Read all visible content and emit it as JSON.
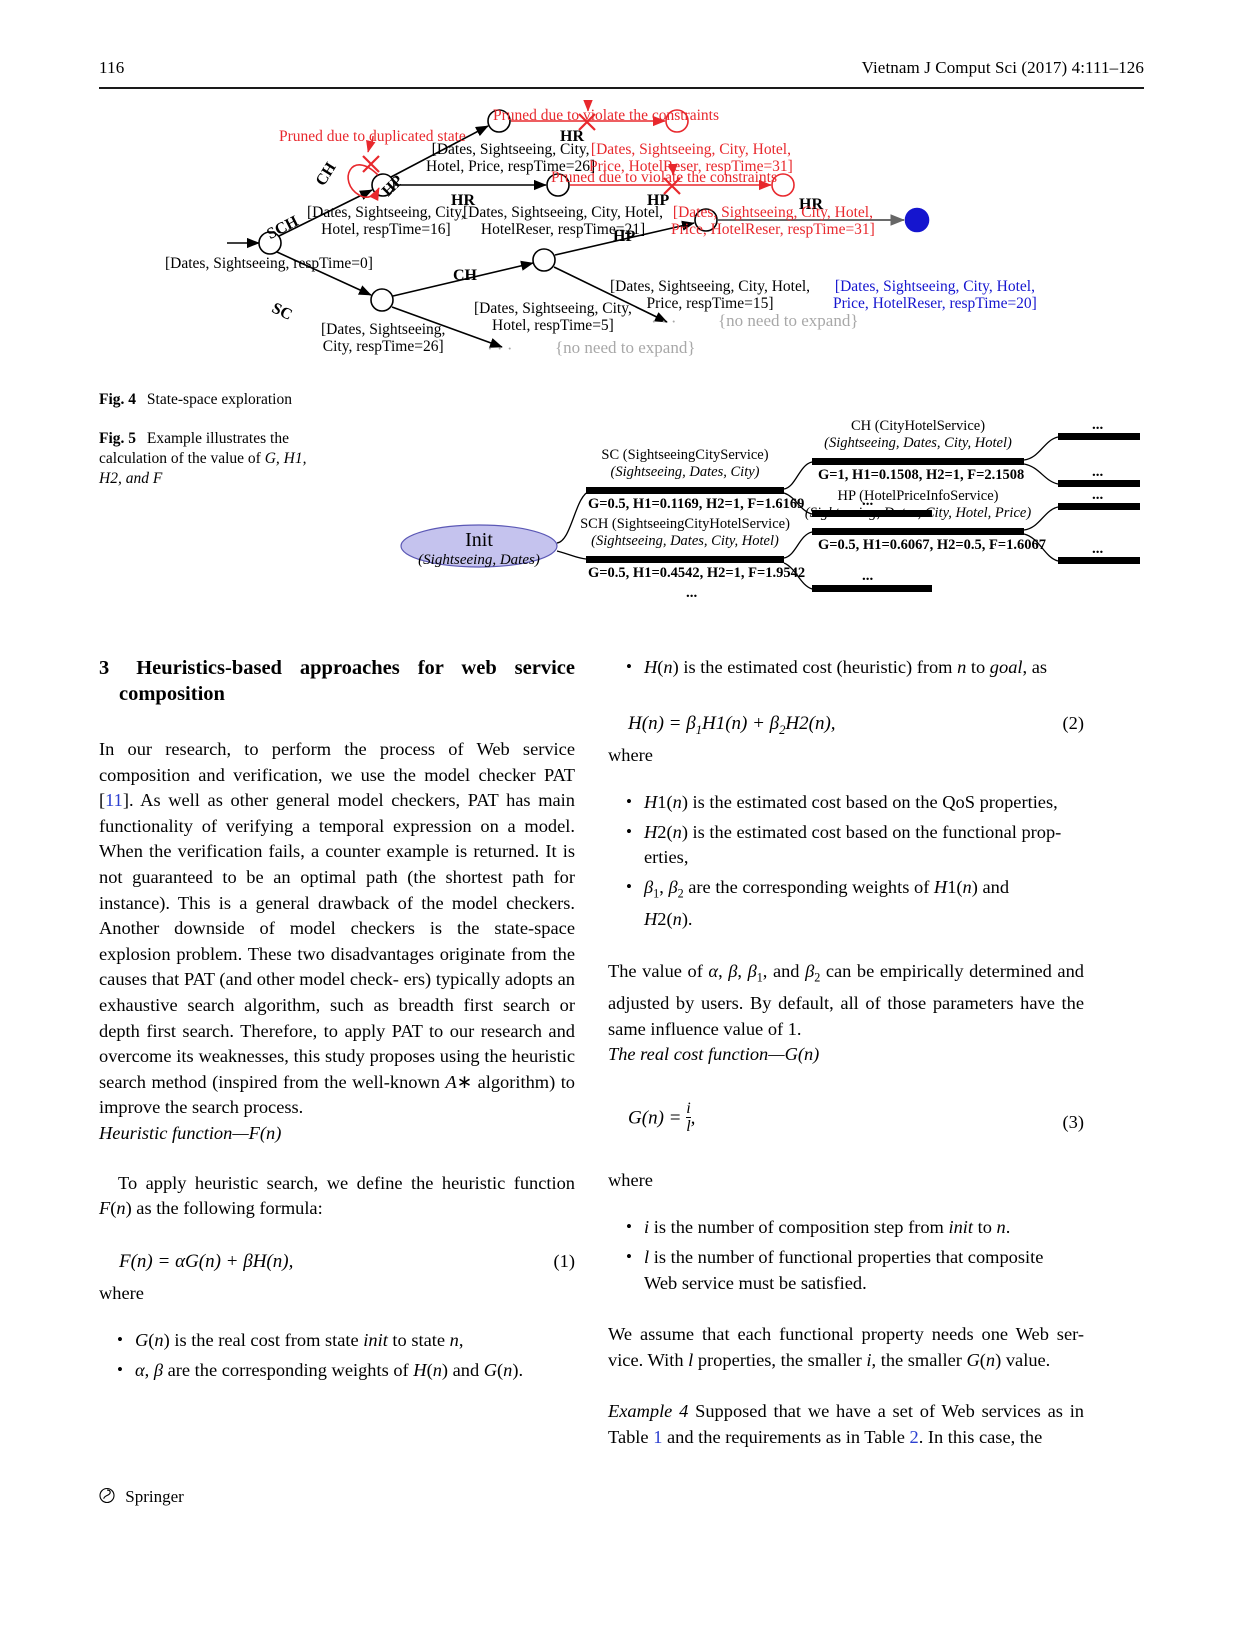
{
  "header": {
    "page_number": "116",
    "journal_ref": "Vietnam J Comput Sci (2017) 4:111–126"
  },
  "figure4": {
    "caption_label": "Fig. 4",
    "caption_text": "State-space exploration",
    "annotations": {
      "pruned_duplicated": "Pruned due to duplicated state",
      "pruned_constraints_1": "Pruned due to violate  the  constraints",
      "pruned_constraints_2": "Pruned due to violate the constraints",
      "pruned_constraints_3": "Pruned due to violate the constraints",
      "no_need_expand_1": "{no need to expand}",
      "no_need_expand_2": "{no need to expand}",
      "ellipsis_1": "· · ·",
      "ellipsis_2": "· · ·"
    },
    "edge_labels": {
      "ch_loop": "CH",
      "hp_up": "HP",
      "sch": "SCH",
      "hr_top": "HR",
      "hr_mid": "HR",
      "hp_mid": "HP",
      "sc": "SC",
      "ch_low": "CH",
      "hp_low": "HP",
      "hr_low": "HR"
    },
    "states": {
      "init": "[Dates, Sightseeing, respTime=0]",
      "sch_node": "[Dates, Sightseeing, City,\nHotel, respTime=16]",
      "hr_node": "[Dates, Sightseeing, City, Hotel,\nHotelReser, respTime=21]",
      "hp_top_node": "[Dates, Sightseeing, City,\nHotel, Price, respTime=26]",
      "hr_top_pruned": "[Dates, Sightseeing, City, Hotel,\nPrice, HotelReser, respTime=31]",
      "hp_mid_pruned": "[Dates, Sightseeing, City, Hotel,\nPrice, HotelReser, respTime=31]",
      "sc_node": "[Dates, Sightseeing,\nCity, respTime=26]",
      "ch_node": "[Dates, Sightseeing, City,\nHotel, respTime=5]",
      "hp_node": "[Dates, Sightseeing, City, Hotel,\nPrice, respTime=15]",
      "goal_node": "[Dates, Sightseeing, City, Hotel,\nPrice, HotelReser, respTime=20]"
    },
    "colors": {
      "pruned": "#e8282d",
      "goal": "#1515cf",
      "normal": "#000000",
      "faded": "#a8a8a8"
    }
  },
  "figure5": {
    "caption_label": "Fig. 5",
    "caption_line1": "Example illustrates the",
    "caption_line2": "calculation of the value of",
    "caption_line3": "G, H1, H2, and F",
    "root": {
      "name": "Init",
      "properties": "(Sightseeing, Dates)",
      "fill": "#c5c3ee"
    },
    "level1": [
      {
        "title": "SC (SightseeingCityService)",
        "properties": "(Sightseeing, Dates, City)",
        "values": "G=0.5, H1=0.1169, H2=1, F=1.6169"
      },
      {
        "title": "SCH (SightseeingCityHotelService)",
        "properties": "(Sightseeing, Dates, City, Hotel)",
        "values": "G=0.5, H1=0.4542, H2=1, F=1.9542"
      }
    ],
    "level2": [
      {
        "title": "CH (CityHotelService)",
        "properties": "(Sightseeing, Dates, City, Hotel)",
        "values": "G=1, H1=0.1508, H2=1, F=2.1508"
      },
      {
        "title": "HP (HotelPriceInfoService)",
        "properties": "(Sightseeing, Dates, City, Hotel, Price)",
        "values": "G=0.5, H1=0.6067, H2=0.5, F=1.6067"
      }
    ],
    "ellipsis": "..."
  },
  "section": {
    "number": "3",
    "title": "Heuristics-based approaches for web service composition"
  },
  "left_column": {
    "para1": "In our research, to perform the process of Web service composition and verification, we use the model checker PAT [11]. As well as other general model checkers, PAT has main functionality of verifying a temporal expression on a model. When the verification fails, a counter example is returned. It is not guaranteed to be an optimal path (the shortest path for instance). This is a general drawback of the model checkers. Another downside of model checkers is the state-space explosion problem. These two disadvantages originate from the causes that PAT (and other model checkers) typically adopts an exhaustive search algorithm, such as breadth first search or depth first search. Therefore, to apply PAT to our research and overcome its weaknesses, this study proposes using the heuristic search method (inspired from the well-known A∗ algorithm) to improve the search process.",
    "citation": "11",
    "subhead": "Heuristic function—F(n)",
    "para2": "To apply heuristic search, we define the heuristic function F(n) as the following formula:",
    "eq1": "F(n) = αG(n) + βH(n),",
    "eq1_num": "(1)",
    "where": "where",
    "bullets": [
      "G(n) is the real cost from state init to state n,",
      "α, β are the corresponding weights of H(n) and G(n)."
    ]
  },
  "right_column": {
    "bullet_top": "H(n) is the estimated cost (heuristic) from n to goal, as",
    "eq2": "H(n) = β1H1(n) + β2H2(n),",
    "eq2_num": "(2)",
    "where1": "where",
    "bullets1": [
      "H1(n) is the estimated cost based on the QoS properties,",
      "H2(n) is the estimated cost based on the functional properties,",
      "β1, β2 are the corresponding weights of H1(n) and H2(n)."
    ],
    "para1": "The value of α, β, β1, and β2 can be empirically determined and adjusted by users. By default, all of those parameters have the same influence value of 1.",
    "subhead": "The real cost function—G(n)",
    "eq3": "G(n) =",
    "eq3_num": "(3)",
    "eq3_frac_num": "i",
    "eq3_frac_den": "l",
    "where2": "where",
    "bullets2": [
      "i is the number of composition step from init to n.",
      "l is the number of functional properties that composite Web service must be satisfied."
    ],
    "para2": "We assume that each functional property needs one Web service. With l properties, the smaller i, the smaller G(n) value.",
    "example_label": "Example 4",
    "example_text": "Supposed that we have a set of Web services as in Table 1 and the requirements as in Table 2. In this case, the",
    "table_ref_1": "1",
    "table_ref_2": "2"
  },
  "footer": {
    "publisher": "Springer"
  }
}
